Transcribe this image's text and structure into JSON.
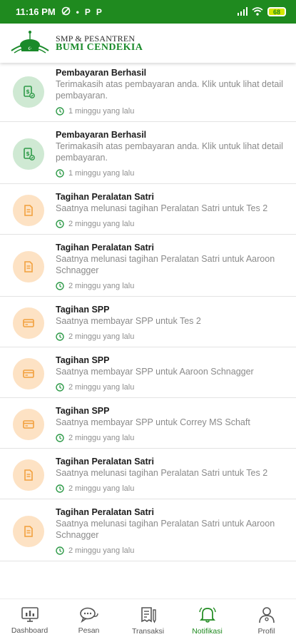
{
  "status_bar": {
    "time": "11:16 PM",
    "apps": [
      "P",
      "P"
    ],
    "battery": "68"
  },
  "header": {
    "line1": "SMP & PESANTREN",
    "line2": "BUMI CENDEKIA"
  },
  "notifications": [
    {
      "title": "Pembayaran Berhasil",
      "desc": "Terimakasih atas pembayaran anda. Klik untuk lihat detail pembayaran.",
      "time": "1 minggu yang lalu",
      "kind": "success"
    },
    {
      "title": "Pembayaran Berhasil",
      "desc": "Terimakasih atas pembayaran anda. Klik untuk lihat detail pembayaran.",
      "time": "1 minggu yang lalu",
      "kind": "success"
    },
    {
      "title": "Tagihan Peralatan Satri",
      "desc": "Saatnya melunasi tagihan Peralatan Satri untuk Tes 2",
      "time": "2 minggu yang lalu",
      "kind": "bill"
    },
    {
      "title": "Tagihan Peralatan Satri",
      "desc": "Saatnya melunasi tagihan Peralatan Satri untuk Aaroon Schnagger",
      "time": "2 minggu yang lalu",
      "kind": "bill"
    },
    {
      "title": "Tagihan SPP",
      "desc": "Saatnya membayar SPP untuk Tes 2",
      "time": "2 minggu yang lalu",
      "kind": "spp"
    },
    {
      "title": "Tagihan SPP",
      "desc": "Saatnya membayar SPP untuk Aaroon Schnagger",
      "time": "2 minggu yang lalu",
      "kind": "spp"
    },
    {
      "title": "Tagihan SPP",
      "desc": "Saatnya membayar SPP untuk Correy MS Schaft",
      "time": "2 minggu yang lalu",
      "kind": "spp"
    },
    {
      "title": "Tagihan Peralatan Satri",
      "desc": "Saatnya melunasi tagihan Peralatan Satri untuk Tes 2",
      "time": "2 minggu yang lalu",
      "kind": "bill"
    },
    {
      "title": "Tagihan Peralatan Satri",
      "desc": "Saatnya melunasi tagihan Peralatan Satri untuk Aaroon Schnagger",
      "time": "2 minggu yang lalu",
      "kind": "bill"
    }
  ],
  "nav": [
    {
      "label": "Dashboard",
      "icon": "dashboard-icon",
      "active": false
    },
    {
      "label": "Pesan",
      "icon": "chat-icon",
      "active": false
    },
    {
      "label": "Transaksi",
      "icon": "transaction-icon",
      "active": false
    },
    {
      "label": "Notifikasi",
      "icon": "bell-icon",
      "active": true
    },
    {
      "label": "Profil",
      "icon": "profile-icon",
      "active": false
    }
  ],
  "colors": {
    "primary": "#1f8a1f",
    "success_bg": "#cfe9d3",
    "bill_bg": "#fde2c4",
    "bill_icon": "#f2a03d",
    "success_icon": "#2e9a48"
  }
}
